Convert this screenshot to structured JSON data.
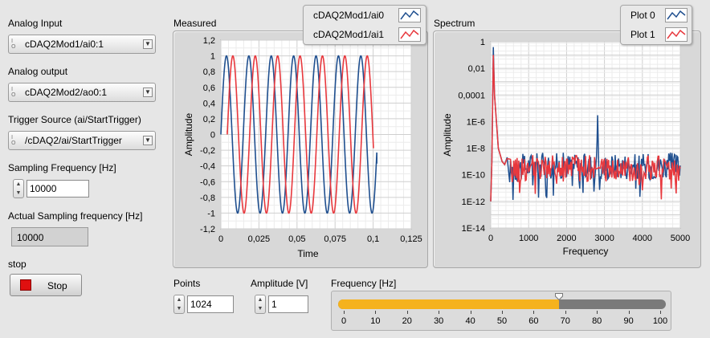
{
  "controls": {
    "analog_input": {
      "label": "Analog Input",
      "value": "cDAQ2Mod1/ai0:1"
    },
    "analog_output": {
      "label": "Analog output",
      "value": "cDAQ2Mod2/ao0:1"
    },
    "trigger_source": {
      "label": "Trigger Source (ai/StartTrigger)",
      "value": "/cDAQ2/ai/StartTrigger"
    },
    "sampling_frequency": {
      "label": "Sampling Frequency [Hz]",
      "value": "10000"
    },
    "actual_sampling": {
      "label": "Actual Sampling frequency [Hz]",
      "value": "10000"
    },
    "stop": {
      "label": "stop",
      "button": "Stop"
    },
    "points": {
      "label": "Points",
      "value": "1024"
    },
    "amplitude": {
      "label": "Amplitude [V]",
      "value": "1"
    },
    "frequency": {
      "label": "Frequency [Hz]",
      "value": 68,
      "ticks": [
        "0",
        "10",
        "20",
        "30",
        "40",
        "50",
        "60",
        "70",
        "80",
        "90",
        "100"
      ],
      "fill_color": "#f5b21d"
    }
  },
  "icons": {
    "io": "io-constant-icon",
    "dropdown": "dropdown-arrow-icon",
    "spinner": "increment-decrement-icon"
  },
  "chart_data": [
    {
      "type": "line",
      "title": "Measured",
      "xlabel": "Time",
      "ylabel": "Amplitude",
      "xlim": [
        0,
        0.125
      ],
      "ylim": [
        -1.2,
        1.2
      ],
      "x_ticks": [
        "0",
        "0,025",
        "0,05",
        "0,075",
        "0,1",
        "0,125"
      ],
      "y_ticks": [
        "1,2",
        "1",
        "0,8",
        "0,6",
        "0,4",
        "0,2",
        "0",
        "-0,2",
        "-0,4",
        "-0,6",
        "-0,8",
        "-1",
        "-1,2"
      ],
      "grid": true,
      "legend_position": "top-right",
      "series": [
        {
          "name": "cDAQ2Mod1/ai0",
          "color": "#1f4f8f",
          "frequency_hz": 68,
          "amplitude": 1,
          "x_end": 0.1024,
          "x": [
            0,
            0.00368,
            0.00735,
            0.01103,
            0.01471,
            0.01838,
            0.02206,
            0.02574,
            0.02941,
            0.03309,
            0.03676,
            0.04044,
            0.04412,
            0.04779,
            0.05147,
            0.05515,
            0.05882,
            0.0625,
            0.06618,
            0.06985,
            0.07353,
            0.07721,
            0.08088,
            0.08456,
            0.08824,
            0.09191,
            0.09559,
            0.09926,
            0.1024
          ],
          "y": [
            0,
            1,
            0,
            -1,
            0,
            1,
            0,
            -1,
            0,
            1,
            0,
            -1,
            0,
            1,
            0,
            -1,
            0,
            1,
            0,
            -1,
            0,
            1,
            0,
            -1,
            0,
            1,
            0,
            -1,
            -0.37
          ]
        },
        {
          "name": "cDAQ2Mod1/ai1",
          "color": "#e8383d",
          "frequency_hz": 68,
          "amplitude": 1,
          "x_start": 0.0042,
          "x_end": 0.1002
        }
      ]
    },
    {
      "type": "line",
      "title": "Spectrum",
      "xlabel": "Frequency",
      "ylabel": "Amplitude",
      "xlim": [
        0,
        5000
      ],
      "ylim": [
        1e-14,
        1
      ],
      "yscale": "log",
      "x_ticks": [
        "0",
        "1000",
        "2000",
        "3000",
        "4000",
        "5000"
      ],
      "y_ticks": [
        "1",
        "0,01",
        "0,0001",
        "1E-6",
        "1E-8",
        "1E-10",
        "1E-12",
        "1E-14"
      ],
      "grid": true,
      "legend_position": "top-right",
      "series": [
        {
          "name": "Plot 0",
          "color": "#1f4f8f",
          "x": [
            0,
            30,
            68,
            100,
            150,
            200,
            300,
            500,
            1000,
            1500,
            2000,
            2500,
            2790,
            2820,
            2850,
            3000,
            3500,
            4000,
            4500,
            5000
          ],
          "y": [
            1e-12,
            1e-09,
            0.4,
            0.0001,
            1e-06,
            1e-08,
            1e-09,
            2e-10,
            5e-10,
            5e-10,
            5e-10,
            4e-10,
            5e-10,
            3e-06,
            5e-10,
            4e-10,
            5e-10,
            4e-10,
            5e-10,
            5e-10
          ]
        },
        {
          "name": "Plot 1",
          "color": "#e8383d",
          "x": [
            0,
            30,
            68,
            100,
            150,
            200,
            300,
            500,
            1000,
            1500,
            2000,
            2500,
            3000,
            3500,
            4000,
            4500,
            5000
          ],
          "y": [
            1e-12,
            1e-09,
            0.1,
            0.0001,
            1e-06,
            1e-08,
            1e-09,
            2e-10,
            3e-10,
            3e-10,
            3e-10,
            3e-10,
            3e-10,
            3e-10,
            3e-10,
            3e-10,
            3e-10
          ]
        }
      ]
    }
  ]
}
